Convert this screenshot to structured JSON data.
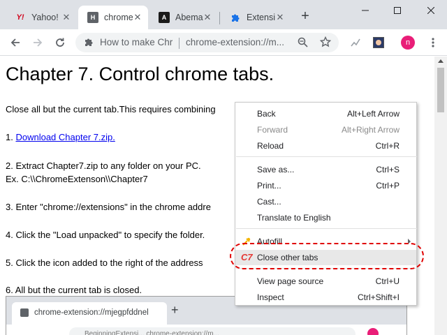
{
  "tabs": [
    {
      "title": "Yahoo!",
      "icon": "yahoo-icon"
    },
    {
      "title": "chrome",
      "icon": "h-favicon-icon"
    },
    {
      "title": "Abema",
      "icon": "abema-icon"
    },
    {
      "title": "Extensi",
      "icon": "puzzle-icon"
    }
  ],
  "toolbar": {
    "omnibox_title": "How to make Chr",
    "omnibox_url": "chrome-extension://m...",
    "avatar_letter": "n"
  },
  "page": {
    "heading": "Chapter 7. Control chrome tabs.",
    "intro": "Close all but the current tab.This requires combining",
    "step1_prefix": "1. ",
    "step1_link": "Download Chapter 7.zip.",
    "step2_line1": "2. Extract Chapter7.zip to any folder on your PC.",
    "step2_line2": "Ex. C:\\\\ChromeExtenson\\\\Chapter7",
    "step3": "3. Enter \"chrome://extensions\" in the chrome addre",
    "step4": "4. Click the \"Load unpacked\" to specify the folder.",
    "step5": "5. Click the icon added to the right of the address",
    "step6": "6. All but the current tab is closed."
  },
  "embedded": {
    "tab_title": "chrome-extension://mjegpfddnel",
    "omnibox": "BeginningExtensi...   chrome-extension://m..."
  },
  "context_menu": {
    "back": {
      "label": "Back",
      "shortcut": "Alt+Left Arrow"
    },
    "forward": {
      "label": "Forward",
      "shortcut": "Alt+Right Arrow"
    },
    "reload": {
      "label": "Reload",
      "shortcut": "Ctrl+R"
    },
    "save_as": {
      "label": "Save as...",
      "shortcut": "Ctrl+S"
    },
    "print": {
      "label": "Print...",
      "shortcut": "Ctrl+P"
    },
    "cast": {
      "label": "Cast..."
    },
    "translate": {
      "label": "Translate to English"
    },
    "autofill": {
      "label": "Autofill"
    },
    "close_other_tabs": {
      "label": "Close other tabs",
      "icon_text": "C7"
    },
    "view_source": {
      "label": "View page source",
      "shortcut": "Ctrl+U"
    },
    "inspect": {
      "label": "Inspect",
      "shortcut": "Ctrl+Shift+I"
    }
  },
  "colors": {
    "tabstrip_bg": "#dee1e6",
    "highlight_oval": "#e00000",
    "link": "#0000ee",
    "avatar": "#e91e78"
  }
}
